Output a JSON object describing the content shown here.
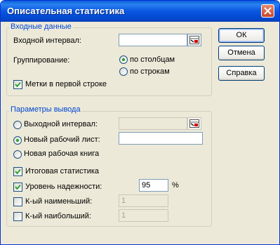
{
  "window": {
    "title": "Описательная статистика"
  },
  "input_group": {
    "legend": "Входные данные",
    "input_range_label": "Входной интервал:",
    "input_range_value": "",
    "grouping_label": "Группирование:",
    "by_columns_label": "по столбцам",
    "by_rows_label": "по строкам",
    "grouping_selected": "по столбцам",
    "labels_first_row_label": "Метки в первой строке",
    "labels_first_row_checked": true
  },
  "output_group": {
    "legend": "Параметры вывода",
    "output_range_label": "Выходной интервал:",
    "output_range_value": "",
    "new_sheet_label": "Новый рабочий лист:",
    "new_sheet_value": "",
    "new_workbook_label": "Новая рабочая книга",
    "output_selected": "Новый рабочий лист",
    "summary_stats_label": "Итоговая статистика",
    "summary_stats_checked": true,
    "confidence_label": "Уровень надежности:",
    "confidence_checked": true,
    "confidence_value": "95",
    "confidence_unit": "%",
    "kth_smallest_label": "К-ый наименьший:",
    "kth_smallest_checked": false,
    "kth_smallest_value": "1",
    "kth_largest_label": "К-ый наибольший:",
    "kth_largest_checked": false,
    "kth_largest_value": "1"
  },
  "buttons": {
    "ok": "ОК",
    "cancel": "Отмена",
    "help": "Справка"
  },
  "colors": {
    "title_bar": "#0a56e0",
    "legend_text": "#0046d5",
    "dialog_bg": "#ece9d8"
  }
}
